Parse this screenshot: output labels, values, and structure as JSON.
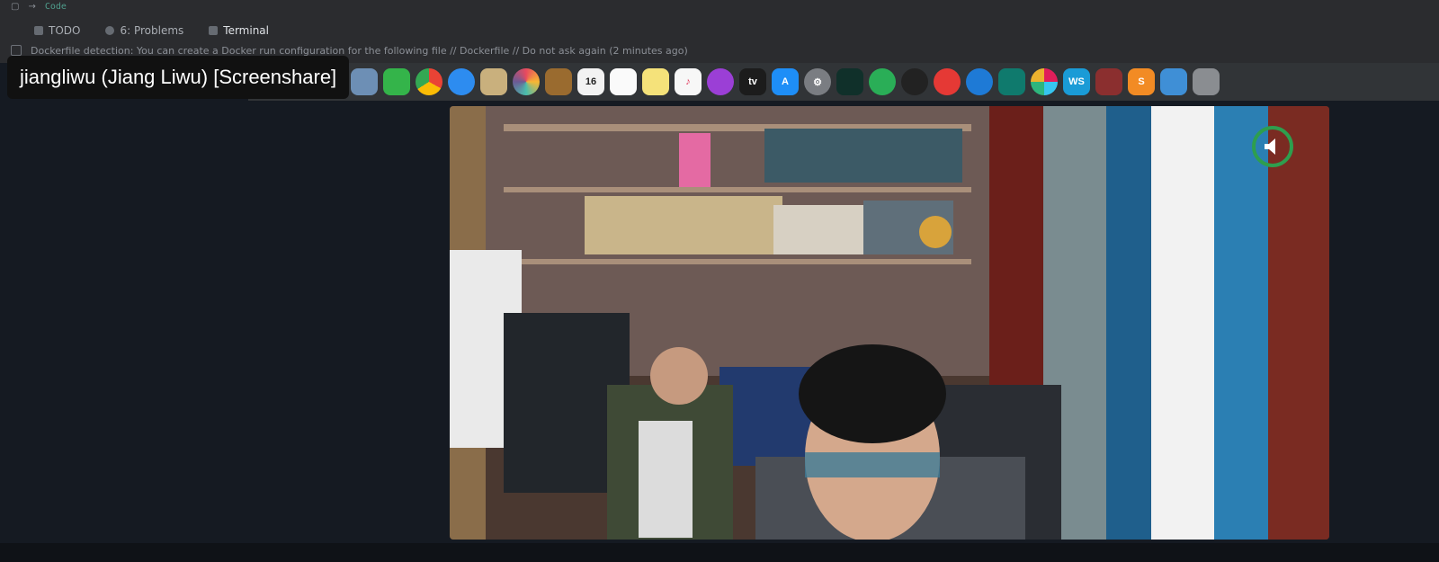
{
  "ide": {
    "code_hint": "Code",
    "tabs": [
      {
        "label": "TODO",
        "icon": "list-icon"
      },
      {
        "label": "6: Problems",
        "icon": "warning-icon"
      },
      {
        "label": "Terminal",
        "icon": "terminal-icon"
      }
    ],
    "status_message": "Dockerfile detection: You can create a Docker run configuration for the following file // Dockerfile // Do not ask again (2 minutes ago)"
  },
  "share": {
    "presenter_label": "jiangliwu (Jiang Liwu) [Screenshare]"
  },
  "dock": {
    "calendar_day": "16",
    "tv_label": "tv",
    "webstorm_label": "WS"
  },
  "colors": {
    "ide_bg": "#2b2c2f",
    "dock_bg": "#313437",
    "page_bg": "#151a22",
    "audio_green": "#2e9e4e"
  }
}
